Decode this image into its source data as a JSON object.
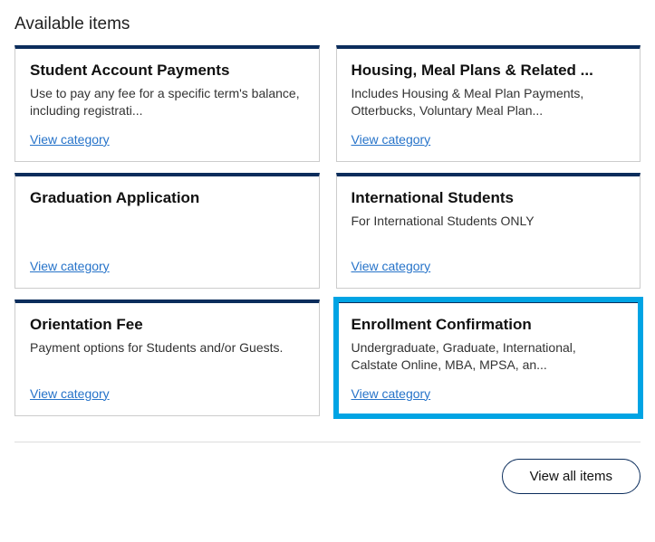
{
  "section_title": "Available items",
  "cards": [
    {
      "title": "Student Account Payments",
      "desc": "Use to pay any fee for a specific term's balance, including registrati...",
      "link_label": "View category",
      "highlighted": false
    },
    {
      "title": "Housing, Meal Plans & Related ...",
      "desc": "Includes Housing & Meal Plan Payments, Otterbucks, Voluntary Meal Plan...",
      "link_label": "View category",
      "highlighted": false
    },
    {
      "title": "Graduation Application",
      "desc": "",
      "link_label": "View category",
      "highlighted": false
    },
    {
      "title": "International Students",
      "desc": "For International Students ONLY",
      "link_label": "View category",
      "highlighted": false
    },
    {
      "title": "Orientation Fee",
      "desc": "Payment options for Students and/or Guests.",
      "link_label": "View category",
      "highlighted": false
    },
    {
      "title": "Enrollment Confirmation",
      "desc": "Undergraduate, Graduate, International, Calstate Online, MBA, MPSA, an...",
      "link_label": "View category",
      "highlighted": true
    }
  ],
  "footer": {
    "view_all_label": "View all items"
  }
}
